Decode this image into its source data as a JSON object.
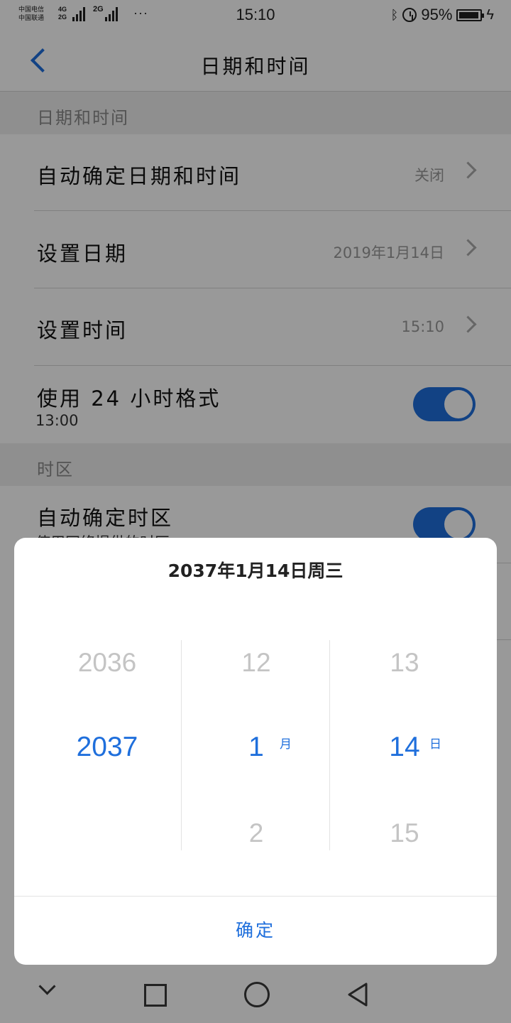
{
  "status_bar": {
    "carrier1": "中国电信",
    "carrier2": "中国联通",
    "net1": "4G",
    "net2": "2G",
    "net3": "2G",
    "dots": "···",
    "time": "15:10",
    "battery": "95%"
  },
  "header": {
    "title": "日期和时间"
  },
  "sections": {
    "date_time": "日期和时间",
    "timezone": "时区"
  },
  "rows": {
    "auto_datetime": {
      "label": "自动确定日期和时间",
      "value": "关闭"
    },
    "set_date": {
      "label": "设置日期",
      "value": "2019年1月14日"
    },
    "set_time": {
      "label": "设置时间",
      "value": "15:10"
    },
    "use_24h": {
      "label": "使用 24 小时格式",
      "sub": "13:00",
      "on": true
    },
    "auto_timezone": {
      "label": "自动确定时区",
      "sub": "使用网络提供的时区",
      "on": true
    }
  },
  "dialog": {
    "title": "2037年1月14日周三",
    "year": {
      "prev": "2036",
      "selected": "2037"
    },
    "month": {
      "prev": "12",
      "selected": "1",
      "next": "2",
      "unit": "月"
    },
    "day": {
      "prev": "13",
      "selected": "14",
      "next": "15",
      "unit": "日"
    },
    "confirm": "确定"
  },
  "colors": {
    "accent": "#1f6fdc"
  },
  "icons": [
    "back-icon",
    "chevron-right-icon",
    "bluetooth-icon",
    "alarm-icon",
    "battery-icon",
    "charging-icon",
    "nav-down-icon",
    "nav-recents-icon",
    "nav-home-icon",
    "nav-back-icon"
  ]
}
